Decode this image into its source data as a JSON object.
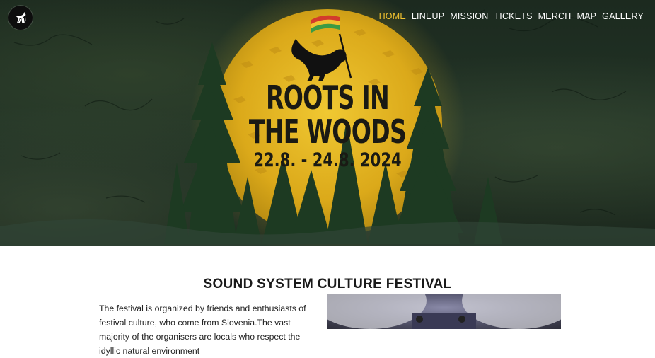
{
  "site": {
    "logo_icon": "wolf-logo-icon"
  },
  "nav": {
    "items": [
      {
        "label": "HOME",
        "active": true
      },
      {
        "label": "LINEUP",
        "active": false
      },
      {
        "label": "MISSION",
        "active": false
      },
      {
        "label": "TICKETS",
        "active": false
      },
      {
        "label": "MERCH",
        "active": false
      },
      {
        "label": "MAP",
        "active": false
      },
      {
        "label": "GALLERY",
        "active": false
      }
    ]
  },
  "hero": {
    "title_line1": "ROOTS IN",
    "title_line2": "THE WOODS",
    "dates": "22.8. - 24.8. 2024",
    "colors": {
      "moon": "#e2b21c",
      "forest": "#1f3322",
      "accent": "#f2c230"
    }
  },
  "main": {
    "heading": "SOUND SYSTEM CULTURE FESTIVAL",
    "intro": "The festival is organized by friends and enthusiasts of festival culture, who come from Slovenia.The vast majority of the organisers are locals who respect the idyllic natural environment"
  }
}
